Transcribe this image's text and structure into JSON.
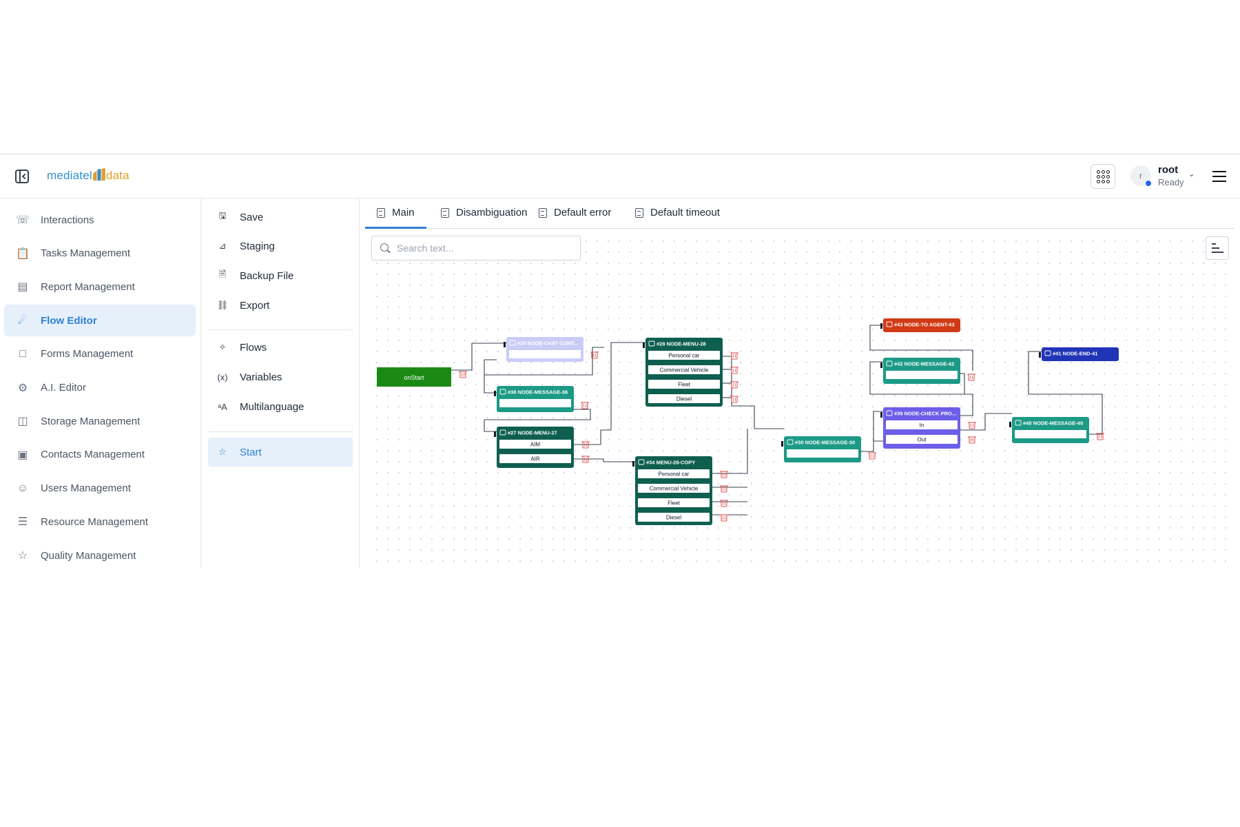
{
  "header": {
    "logo_text_1": "mediatel",
    "logo_text_2": "data",
    "user_initial": "r",
    "user_name": "root",
    "user_status": "Ready"
  },
  "sidebar": {
    "items": [
      {
        "label": "Interactions",
        "icon": "phone-icon"
      },
      {
        "label": "Tasks Management",
        "icon": "clipboard-icon"
      },
      {
        "label": "Report Management",
        "icon": "bar-chart-icon"
      },
      {
        "label": "Flow Editor",
        "icon": "flow-icon",
        "active": true
      },
      {
        "label": "Forms Management",
        "icon": "form-icon"
      },
      {
        "label": "A.I. Editor",
        "icon": "robot-icon"
      },
      {
        "label": "Storage Management",
        "icon": "archive-icon"
      },
      {
        "label": "Contacts Management",
        "icon": "contact-card-icon"
      },
      {
        "label": "Users Management",
        "icon": "users-icon"
      },
      {
        "label": "Resource Management",
        "icon": "sliders-icon"
      },
      {
        "label": "Quality Management",
        "icon": "star-icon"
      }
    ]
  },
  "actions": {
    "save": "Save",
    "staging": "Staging",
    "backup": "Backup File",
    "export": "Export",
    "flows": "Flows",
    "variables": "Variables",
    "multilanguage": "Multilanguage",
    "start": "Start"
  },
  "tabs": [
    "Main",
    "Disambiguation",
    "Default error",
    "Default timeout"
  ],
  "search": {
    "placeholder": "Search text...",
    "value": ""
  },
  "flow": {
    "start_label": "onStart",
    "nodes": [
      {
        "id": "n35",
        "title": "#35 NODE-CHAT CONT...",
        "icon": "chat-icon",
        "color": "#c9cdf6",
        "options": []
      },
      {
        "id": "n36",
        "title": "#36 NODE-MESSAGE-36",
        "icon": "message-icon",
        "color": "#1c9a86",
        "options": []
      },
      {
        "id": "n27",
        "title": "#27 NODE-MENU-27",
        "icon": "menu-icon",
        "color": "#0f5f50",
        "options": [
          "AIM",
          "AIR"
        ]
      },
      {
        "id": "n28",
        "title": "#28 NODE-MENU-28",
        "icon": "menu-icon",
        "color": "#0f5f50",
        "options": [
          "Personal car",
          "Commercial Vehicle",
          "Fleet",
          "Diesel"
        ]
      },
      {
        "id": "n34",
        "title": "#34 MENU-28-COPY",
        "icon": "menu-icon",
        "color": "#0f5f50",
        "options": [
          "Personal car",
          "Commercial Vehicle",
          "Fleet",
          "Diesel"
        ]
      },
      {
        "id": "n30",
        "title": "#30 NODE-MESSAGE-30",
        "icon": "message-icon",
        "color": "#1c9a86",
        "options": []
      },
      {
        "id": "n43",
        "title": "#43 NODE-TO AGENT-43",
        "icon": "agent-icon",
        "color": "#d23a16",
        "options": []
      },
      {
        "id": "n42",
        "title": "#42 NODE-MESSAGE-42",
        "icon": "message-icon",
        "color": "#1c9a86",
        "options": []
      },
      {
        "id": "n39",
        "title": "#39 NODE-CHECK PRO...",
        "icon": "check-icon",
        "color": "#6c5ee8",
        "options": [
          "In",
          "Out"
        ]
      },
      {
        "id": "n40",
        "title": "#40 NODE-MESSAGE-40",
        "icon": "message-icon",
        "color": "#1c9a86",
        "options": []
      },
      {
        "id": "n41",
        "title": "#41 NODE-END-41",
        "icon": "end-flag-icon",
        "color": "#2034b8",
        "options": []
      }
    ]
  },
  "colors": {
    "accent": "#2f7fd3",
    "active_bg": "#e6f0fb",
    "start_node": "#1b8a14",
    "delete": "#e05555"
  }
}
